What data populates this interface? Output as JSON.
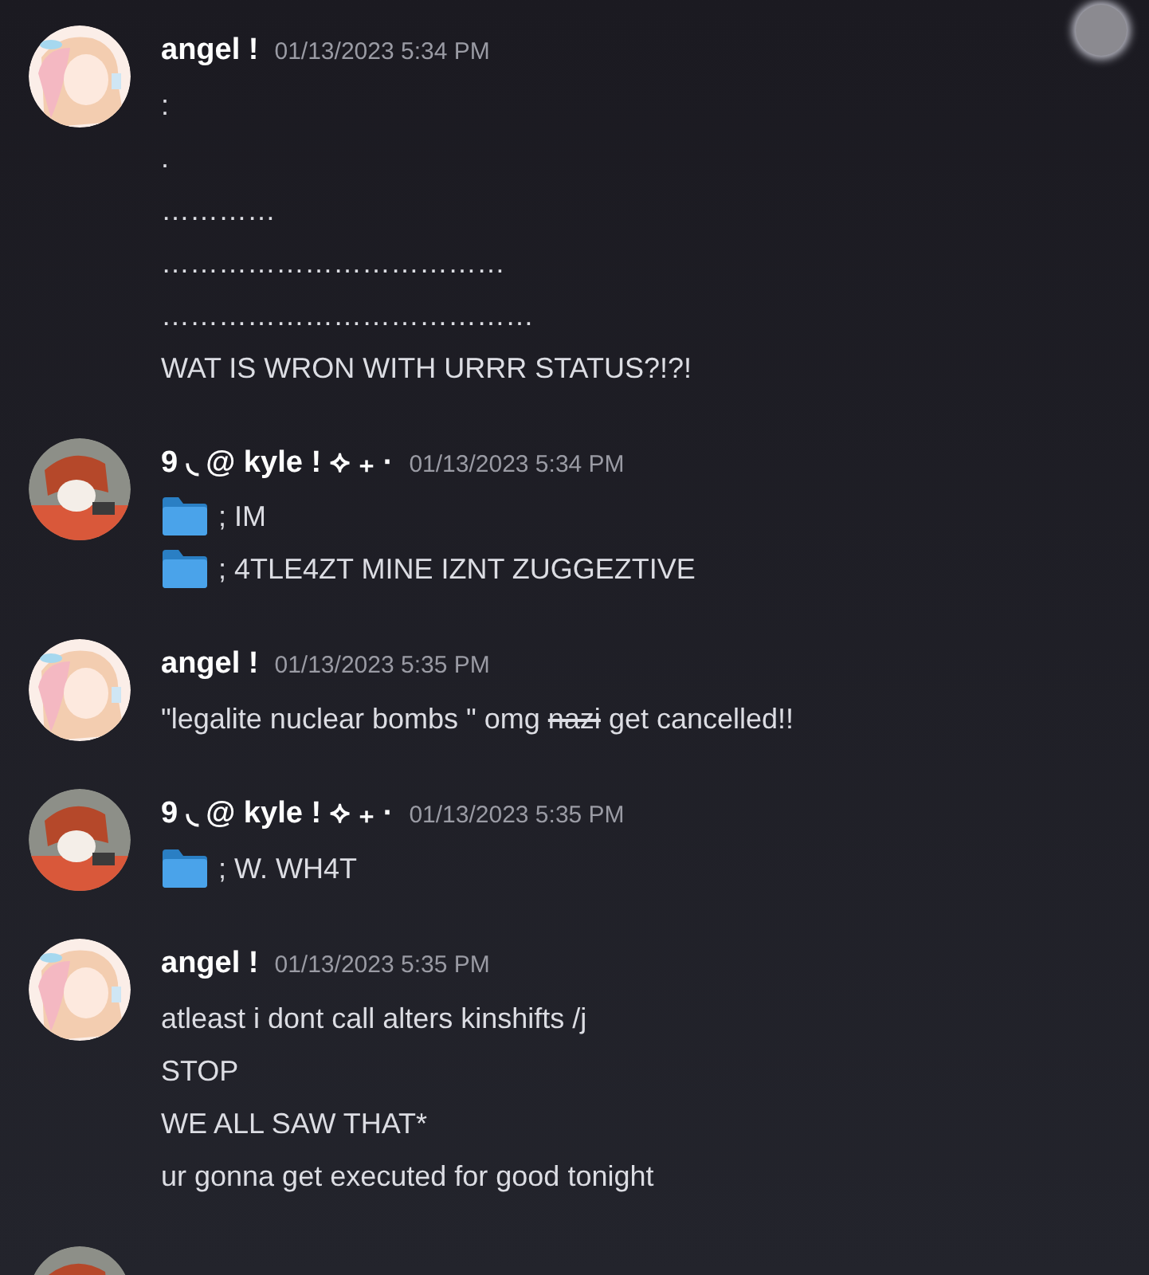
{
  "messages": [
    {
      "avatar": {
        "kind": "blonde"
      },
      "author": "angel !",
      "timestamp": "01/13/2023 5:34 PM",
      "lines": [
        {
          "kind": "text",
          "text": ":"
        },
        {
          "kind": "text",
          "text": "."
        },
        {
          "kind": "text",
          "text": "…………"
        },
        {
          "kind": "text",
          "text": "………………………………"
        },
        {
          "kind": "text",
          "text": "…………………………………"
        },
        {
          "kind": "text",
          "text": "WAT IS WRON WITH URRR STATUS?!?!"
        }
      ]
    },
    {
      "avatar": {
        "kind": "redhead"
      },
      "author": "9 ◟ @ kyle ! ⟡ ₊ ·",
      "timestamp": "01/13/2023 5:34 PM",
      "lines": [
        {
          "kind": "folder",
          "text": "; IM"
        },
        {
          "kind": "folder",
          "text": "; 4TLE4ZT MINE IZNT ZUGGEZTIVE"
        }
      ]
    },
    {
      "avatar": {
        "kind": "blonde"
      },
      "author": "angel !",
      "timestamp": "01/13/2023 5:35 PM",
      "lines": [
        {
          "kind": "text",
          "segments": [
            {
              "text": "\"legalite nuclear bombs \" omg ",
              "struck": false
            },
            {
              "text": "nazi",
              "struck": true
            },
            {
              "text": " get cancelled!!",
              "struck": false
            }
          ]
        }
      ]
    },
    {
      "avatar": {
        "kind": "redhead"
      },
      "author": "9 ◟ @ kyle ! ⟡ ₊ ·",
      "timestamp": "01/13/2023 5:35 PM",
      "lines": [
        {
          "kind": "folder",
          "text": "; W. WH4T"
        }
      ]
    },
    {
      "avatar": {
        "kind": "blonde"
      },
      "author": "angel !",
      "timestamp": "01/13/2023 5:35 PM",
      "lines": [
        {
          "kind": "text",
          "text": "atleast i dont call alters kinshifts /j"
        },
        {
          "kind": "text",
          "text": "STOP"
        },
        {
          "kind": "text",
          "text": "WE ALL SAW THAT*"
        },
        {
          "kind": "text",
          "text": "ur gonna get executed for good tonight"
        }
      ]
    },
    {
      "avatar": {
        "kind": "redhead"
      }
    }
  ]
}
